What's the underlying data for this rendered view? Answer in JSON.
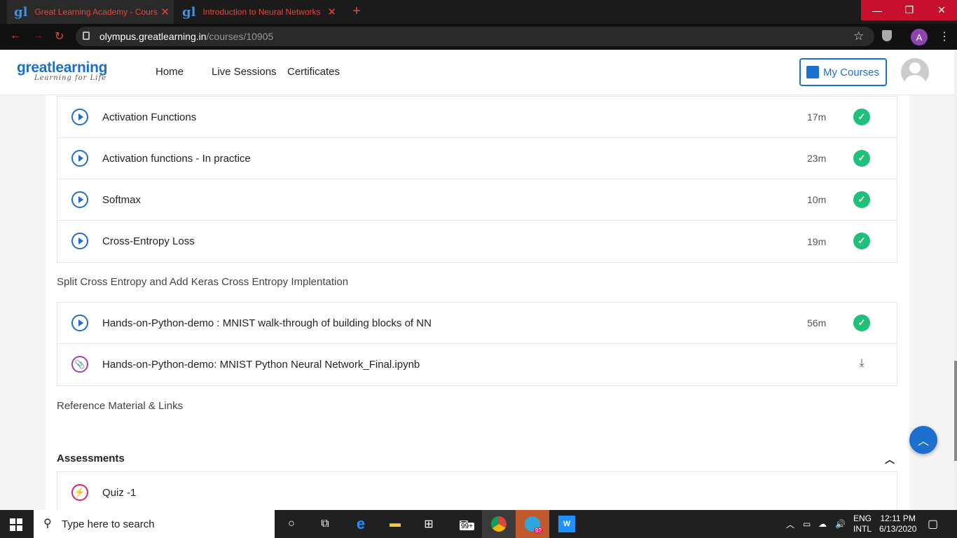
{
  "browser": {
    "tabs": [
      {
        "label": "Great Learning Academy - Cours"
      },
      {
        "label": "Introduction to Neural Networks"
      }
    ],
    "url_host": "olympus.greatlearning.in",
    "url_path": "/courses/10905",
    "profile_initial": "A"
  },
  "header": {
    "brand": "greatlearning",
    "tagline": "Learning for Life",
    "nav": [
      "Home",
      "Live Sessions",
      "Certificates"
    ],
    "my_courses": "My Courses"
  },
  "group1": [
    {
      "title": "Activation Functions",
      "duration": "17m"
    },
    {
      "title": "Activation functions - In practice",
      "duration": "23m"
    },
    {
      "title": "Softmax",
      "duration": "10m"
    },
    {
      "title": "Cross-Entropy Loss",
      "duration": "19m"
    }
  ],
  "section_split": "Split Cross Entropy and Add Keras Cross Entropy Implentation",
  "group2": [
    {
      "title": "Hands-on-Python-demo : MNIST walk-through of building blocks of NN",
      "duration": "56m"
    },
    {
      "title": "Hands-on-Python-demo: MNIST Python Neural Network_Final.ipynb",
      "duration": ""
    }
  ],
  "section_reference": "Reference Material & Links",
  "assessments": {
    "title": "Assessments",
    "items": [
      {
        "title": "Quiz -1"
      }
    ]
  },
  "taskbar": {
    "search_placeholder": "Type here to search",
    "mail_badge": "99+",
    "telegram_badge": "92",
    "lang_top": "ENG",
    "lang_bottom": "INTL",
    "time": "12:11 PM",
    "date": "6/13/2020"
  },
  "colors": {
    "brand_blue": "#1d6fce",
    "check_green": "#1ec07a",
    "tab_red": "#e8453c"
  }
}
